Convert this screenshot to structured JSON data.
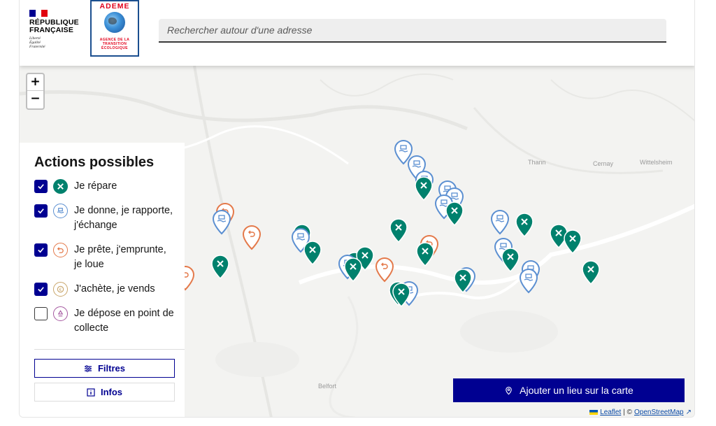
{
  "header": {
    "rf_name": "RÉPUBLIQUE\nFRANÇAISE",
    "rf_motto": "Liberté\nÉgalité\nFraternité",
    "ademe_title": "ADEME",
    "ademe_sub": "AGENCE DE LA\nTRANSITION\nÉCOLOGIQUE",
    "search_placeholder": "Rechercher autour d'une adresse"
  },
  "map": {
    "zoom_in": "+",
    "zoom_out": "−",
    "places": [
      "Thann",
      "Cernay",
      "Wittelsheim",
      "Belfort"
    ]
  },
  "panel": {
    "title": "Actions possibles",
    "options": [
      {
        "label": "Je répare",
        "checked": true,
        "icon": "wrench-icon",
        "color": "#00816d"
      },
      {
        "label": "Je donne, je rapporte, j'échange",
        "checked": true,
        "icon": "give-hand-icon",
        "color": "#5b8fd1"
      },
      {
        "label": "Je prête, j'emprunte, je loue",
        "checked": true,
        "icon": "return-arrow-icon",
        "color": "#e4794a"
      },
      {
        "label": "J'achète, je vends",
        "checked": true,
        "icon": "euro-coin-icon",
        "color": "#c9a66b"
      },
      {
        "label": "Je dépose en point de collecte",
        "checked": false,
        "icon": "recycle-icon",
        "color": "#a558a0"
      }
    ],
    "filtres_label": "Filtres",
    "infos_label": "Infos"
  },
  "add_place_label": "Ajouter un lieu sur la carte",
  "attribution": {
    "leaflet": "Leaflet",
    "sep": "| ©",
    "osm": "OpenStreetMap"
  },
  "colors": {
    "repair": "#00816d",
    "give": "#5b8fd1",
    "lend": "#e4794a",
    "primary": "#000091"
  }
}
